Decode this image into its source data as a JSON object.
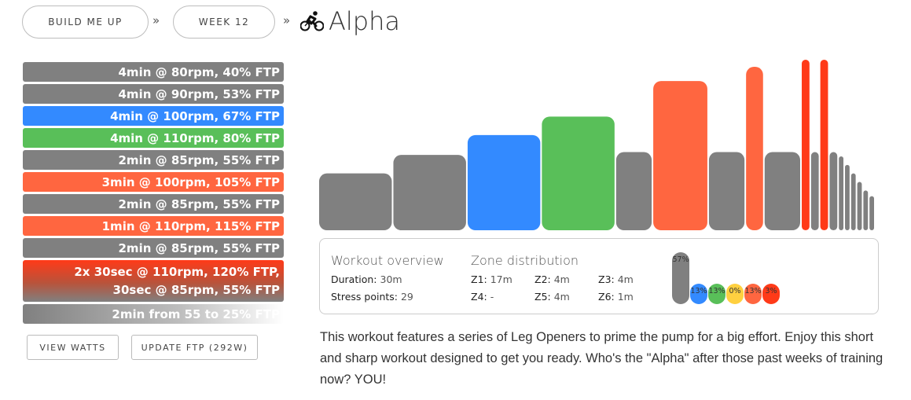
{
  "breadcrumb": {
    "build_label": "BUILD ME UP",
    "week_label": "WEEK 12",
    "separator": "»",
    "workout_title": "Alpha",
    "bike_icon": "cyclist-icon"
  },
  "steps": [
    {
      "label": "4min @ 80rpm, 40% FTP",
      "color": "#808080"
    },
    {
      "label": "4min @ 90rpm, 53% FTP",
      "color": "#808080"
    },
    {
      "label": "4min @ 100rpm, 67% FTP",
      "color": "#338aff"
    },
    {
      "label": "4min @ 110rpm, 80% FTP",
      "color": "#59bf59"
    },
    {
      "label": "2min @ 85rpm, 55% FTP",
      "color": "#808080"
    },
    {
      "label": "3min @ 100rpm, 105% FTP",
      "color": "#ff6640"
    },
    {
      "label": "2min @ 85rpm, 55% FTP",
      "color": "#808080"
    },
    {
      "label": "1min @ 110rpm, 115% FTP",
      "color": "#ff6640"
    },
    {
      "label": "2min @ 85rpm, 55% FTP",
      "color": "#808080"
    }
  ],
  "interval_step": {
    "line1": "2x 30sec @ 110rpm, 120% FTP,",
    "line2": "30sec @ 85rpm, 55% FTP",
    "color_top": "#ff3a18",
    "color_bottom": "#808080"
  },
  "cooldown_step": {
    "label": "2min from 55 to 25% FTP",
    "color_from": "#808080",
    "color_to": "#ffffff"
  },
  "buttons": {
    "view_watts": "VIEW WATTS",
    "update_ftp": "UPDATE FTP (292W)"
  },
  "chart_data": {
    "type": "bar",
    "x_unit": "min",
    "y_unit": "% FTP",
    "ylim": [
      0,
      120
    ],
    "segments": [
      {
        "duration": 4,
        "ftp": 40,
        "color": "#808080"
      },
      {
        "duration": 4,
        "ftp": 53,
        "color": "#808080"
      },
      {
        "duration": 4,
        "ftp": 67,
        "color": "#338aff"
      },
      {
        "duration": 4,
        "ftp": 80,
        "color": "#59bf59"
      },
      {
        "duration": 2,
        "ftp": 55,
        "color": "#808080"
      },
      {
        "duration": 3,
        "ftp": 105,
        "color": "#ff6640"
      },
      {
        "duration": 2,
        "ftp": 55,
        "color": "#808080"
      },
      {
        "duration": 1,
        "ftp": 115,
        "color": "#ff6640"
      },
      {
        "duration": 2,
        "ftp": 55,
        "color": "#808080"
      },
      {
        "duration": 0.5,
        "ftp": 120,
        "color": "#ff3a18"
      },
      {
        "duration": 0.5,
        "ftp": 55,
        "color": "#808080"
      },
      {
        "duration": 0.5,
        "ftp": 120,
        "color": "#ff3a18"
      },
      {
        "duration": 0.5,
        "ftp": 55,
        "color": "#808080"
      },
      {
        "duration": 0.33,
        "ftp": 52,
        "color": "#808080"
      },
      {
        "duration": 0.33,
        "ftp": 46,
        "color": "#808080"
      },
      {
        "duration": 0.33,
        "ftp": 40,
        "color": "#808080"
      },
      {
        "duration": 0.33,
        "ftp": 34,
        "color": "#808080"
      },
      {
        "duration": 0.33,
        "ftp": 28,
        "color": "#808080"
      },
      {
        "duration": 0.33,
        "ftp": 24,
        "color": "#808080"
      }
    ]
  },
  "overview": {
    "heading": "Workout overview",
    "duration_label": "Duration:",
    "duration_value": "30m",
    "stress_label": "Stress points:",
    "stress_value": "29"
  },
  "zones": {
    "heading": "Zone distribution",
    "items": [
      {
        "label": "Z1:",
        "value": "17m"
      },
      {
        "label": "Z2:",
        "value": "4m"
      },
      {
        "label": "Z3:",
        "value": "4m"
      },
      {
        "label": "Z4:",
        "value": "-"
      },
      {
        "label": "Z5:",
        "value": "4m"
      },
      {
        "label": "Z6:",
        "value": "1m"
      }
    ],
    "bars": [
      {
        "pct": "57%",
        "value": 57,
        "color": "#808080"
      },
      {
        "pct": "13%",
        "value": 13,
        "color": "#338aff"
      },
      {
        "pct": "13%",
        "value": 13,
        "color": "#59bf59"
      },
      {
        "pct": "0%",
        "value": 0,
        "color": "#ffd040"
      },
      {
        "pct": "13%",
        "value": 13,
        "color": "#ff6640"
      },
      {
        "pct": "3%",
        "value": 3,
        "color": "#ff3a18"
      }
    ]
  },
  "description": "This workout features a series of Leg Openers to prime the pump for a big effort. Enjoy this short and sharp workout designed to get you ready. Who's the \"Alpha\" after those past weeks of training now? YOU!"
}
